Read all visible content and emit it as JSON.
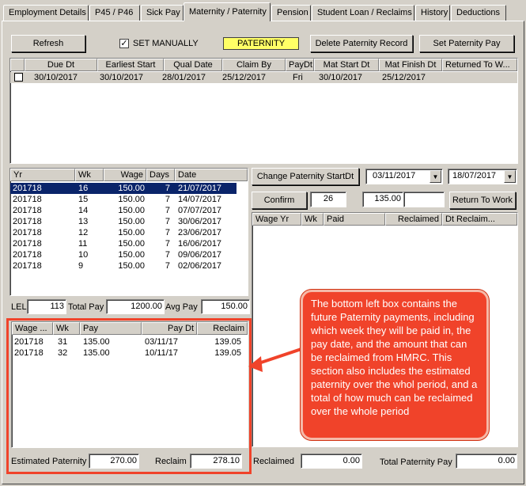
{
  "tabs": [
    {
      "label": "Employment Details",
      "active": false
    },
    {
      "label": "P45 / P46",
      "active": false
    },
    {
      "label": "Sick Pay",
      "active": false
    },
    {
      "label": "Maternity / Paternity",
      "active": true
    },
    {
      "label": "Pension",
      "active": false
    },
    {
      "label": "Student Loan / Reclaims",
      "active": false
    },
    {
      "label": "History",
      "active": false
    },
    {
      "label": "Deductions",
      "active": false
    }
  ],
  "toolbar": {
    "refresh_label": "Refresh",
    "set_manually_label": "SET MANUALLY",
    "set_manually_checked": true,
    "type_badge": "PATERNITY",
    "delete_label": "Delete Paternity Record",
    "set_pay_label": "Set Paternity Pay"
  },
  "records": {
    "columns": [
      "Due Dt",
      "Earliest Start",
      "Qual Date",
      "Claim By",
      "PayDt",
      "Mat Start Dt",
      "Mat Finish Dt",
      "Returned To W..."
    ],
    "rows": [
      {
        "due": "30/10/2017",
        "earliest": "30/10/2017",
        "qual": "28/01/2017",
        "claim_by": "25/12/2017",
        "paydt": "Fri",
        "mat_start": "30/10/2017",
        "mat_finish": "25/12/2017",
        "returned": ""
      }
    ]
  },
  "earnings": {
    "columns": [
      "Yr",
      "Wk",
      "Wage",
      "Days",
      "Date"
    ],
    "rows": [
      {
        "yr": "201718",
        "wk": "16",
        "wage": "150.00",
        "days": "7",
        "date": "21/07/2017"
      },
      {
        "yr": "201718",
        "wk": "15",
        "wage": "150.00",
        "days": "7",
        "date": "14/07/2017"
      },
      {
        "yr": "201718",
        "wk": "14",
        "wage": "150.00",
        "days": "7",
        "date": "07/07/2017"
      },
      {
        "yr": "201718",
        "wk": "13",
        "wage": "150.00",
        "days": "7",
        "date": "30/06/2017"
      },
      {
        "yr": "201718",
        "wk": "12",
        "wage": "150.00",
        "days": "7",
        "date": "23/06/2017"
      },
      {
        "yr": "201718",
        "wk": "11",
        "wage": "150.00",
        "days": "7",
        "date": "16/06/2017"
      },
      {
        "yr": "201718",
        "wk": "10",
        "wage": "150.00",
        "days": "7",
        "date": "09/06/2017"
      },
      {
        "yr": "201718",
        "wk": "9",
        "wage": "150.00",
        "days": "7",
        "date": "02/06/2017"
      }
    ]
  },
  "totals": {
    "lel_label": "LEL",
    "lel_value": "113",
    "total_pay_label": "Total Pay",
    "total_pay_value": "1200.00",
    "avg_pay_label": "Avg Pay",
    "avg_pay_value": "150.00"
  },
  "future": {
    "columns": [
      "Wage ...",
      "Wk",
      "Pay",
      "Pay Dt",
      "Reclaim"
    ],
    "rows": [
      {
        "yr": "201718",
        "wk": "31",
        "pay": "135.00",
        "paydt": "03/11/17",
        "reclaim": "139.05"
      },
      {
        "yr": "201718",
        "wk": "32",
        "pay": "135.00",
        "paydt": "10/11/17",
        "reclaim": "139.05"
      }
    ],
    "estimated_label": "Estimated Paternity",
    "estimated_value": "270.00",
    "reclaim_label": "Reclaim",
    "reclaim_value": "278.10"
  },
  "right": {
    "change_label": "Change Paternity StartDt",
    "start_date": "03/11/2017",
    "end_date": "18/07/2017",
    "confirm_label": "Confirm",
    "weeks_value": "26",
    "rate_value": "135.00",
    "extra_value": "",
    "return_label": "Return To Work",
    "columns": [
      "Wage Yr",
      "Wk",
      "Paid",
      "Reclaimed",
      "Dt Reclaim..."
    ],
    "reclaimed_label": "Reclaimed",
    "reclaimed_value": "0.00",
    "total_label": "Total Paternity Pay",
    "total_value": "0.00"
  },
  "callout": {
    "text": "The bottom left box contains the future Paternity payments, including which week they will be paid in, the pay date, and the amount that can be reclaimed from HMRC. This section also includes the estimated paternity over the whol period, and a total of how much can be reclaimed over the whole period"
  },
  "colors": {
    "accent_red": "#f0432a",
    "badge_yellow": "#ffff66",
    "selection": "#0a246a"
  }
}
